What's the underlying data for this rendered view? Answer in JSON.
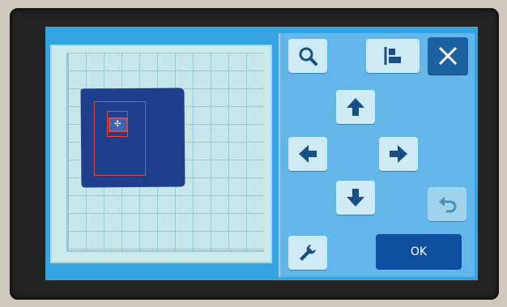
{
  "device": {
    "screen_background": "#35a4e0",
    "panel_background": "#63b6e7"
  },
  "preview": {
    "mat": "cutting-mat-grid",
    "fabric_color": "#1e3f8b",
    "outline_color": "#e3453c"
  },
  "controls": {
    "zoom_icon": "magnifier-icon",
    "align_icon": "align-left-icon",
    "close_icon": "close-icon",
    "up_icon": "arrow-up-icon",
    "left_icon": "arrow-left-icon",
    "right_icon": "arrow-right-icon",
    "down_icon": "arrow-down-icon",
    "undo_icon": "undo-icon",
    "settings_icon": "wrench-icon",
    "ok_label": "OK"
  }
}
